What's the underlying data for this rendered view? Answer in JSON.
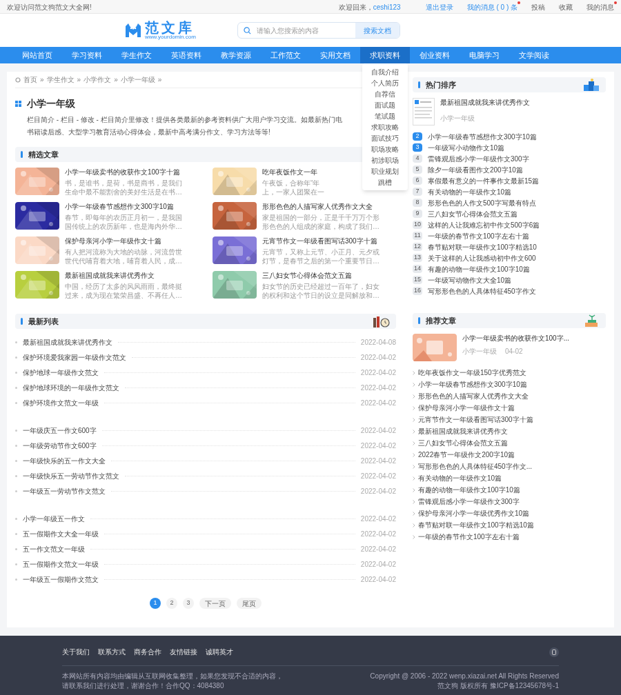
{
  "top_bar": {
    "welcome": "欢迎访问范文狗范文大全网!",
    "greeting": "欢迎回来，",
    "username": "ceshi123",
    "links": [
      {
        "label": "退出登录",
        "kind": "link",
        "unread": false
      },
      {
        "label": "我的消息 ( 0 ) 条",
        "kind": "link",
        "unread": true
      },
      {
        "label": "投稿",
        "kind": "plain",
        "unread": false
      },
      {
        "label": "收藏",
        "kind": "plain",
        "unread": false
      },
      {
        "label": "我的消息",
        "kind": "plain",
        "unread": true
      }
    ]
  },
  "header": {
    "logo": {
      "name": "范文库",
      "domain": "www.yourdomin.com"
    },
    "search": {
      "placeholder": "请输入您搜索的内容",
      "button": "搜索文档"
    }
  },
  "nav": {
    "items": [
      {
        "label": "网站首页",
        "selected": false
      },
      {
        "label": "学习资料",
        "selected": false
      },
      {
        "label": "学生作文",
        "selected": false
      },
      {
        "label": "英语资料",
        "selected": false
      },
      {
        "label": "教学资源",
        "selected": false
      },
      {
        "label": "工作范文",
        "selected": false
      },
      {
        "label": "实用文档",
        "selected": false
      },
      {
        "label": "求职资料",
        "selected": true,
        "dropdown": [
          "自我介绍",
          "个人简历",
          "自荐信",
          "面试题",
          "笔试题",
          "求职攻略",
          "面试技巧",
          "职场攻略",
          "初涉职场",
          "职业规划",
          "跳槽"
        ]
      },
      {
        "label": "创业资料",
        "selected": false
      },
      {
        "label": "电脑学习",
        "selected": false
      },
      {
        "label": "文学阅读",
        "selected": false
      }
    ]
  },
  "breadcrumb": {
    "separator": "»",
    "items": [
      "首页",
      "学生作文",
      "小学作文",
      "小学一年级"
    ]
  },
  "category": {
    "title": "小学一年级",
    "intro_lines": [
      "栏目简介 - 栏目 - 修改 - 栏目简介里修改！提供各类最新的参考资料供广大用户学习交流。如最新热门电",
      "书籍读后感、大型学习教育活动心得体会，最新中高考满分作文、学习方法等等!"
    ]
  },
  "featured": {
    "title": "精选文章",
    "articles": [
      {
        "title": "小学一年级卖书的收获作文100字十篇",
        "desc_lines": [
          "书，是谁书，是荷，书是商书，是我们",
          "生命中最不能割舍的美好生活是在书…"
        ],
        "color": "#f4b497"
      },
      {
        "title": "吃年夜饭作文一年",
        "desc_lines": [
          "午夜饭，合称年“年",
          "上，一家人团聚在一"
        ],
        "color": "#f7dcaa"
      },
      {
        "title": "小学一年级春节感想作文300字10篇",
        "desc_lines": [
          "春节，即每年的农历正月初一，是我国",
          "国传统上的农历新年，也是海内外华…"
        ],
        "color": "#2b2ba0"
      },
      {
        "title": "形形色色的人描写家人优秀作文大全",
        "desc_lines": [
          "家是祖国的一部分，正是千千万万个形",
          "形色色的人组成的家庭，构成了我们…"
        ],
        "color": "#c6643e"
      },
      {
        "title": "保护母亲河小学一年级作文十篇",
        "desc_lines": [
          "有人把河流称为大地的动脉，河流曾世",
          "世代代哺育着大地，哺育着人民，成…"
        ],
        "color": "#fbd9c6"
      },
      {
        "title": "元宵节作文一年级看图写话300字十篇",
        "desc_lines": [
          "元宵节，又称上元节、小正月、元夕或",
          "灯节，是春节之后的第一个重要节日…"
        ],
        "color": "#7a6fd6"
      },
      {
        "title": "最新祖国成就我来讲优秀作文",
        "desc_lines": [
          "中国，经历了太多的风风雨雨，最终挺",
          "过来，成为现在繁荣昌盛、不再任人…"
        ],
        "color": "#b8cf3f"
      },
      {
        "title": "三八妇女节心得体会范文五篇",
        "desc_lines": [
          "妇女节的历史已经超过一百年了，妇女",
          "的权利和这个节日的设立是同解放和…"
        ],
        "color": "#8fcbab"
      }
    ]
  },
  "latest": {
    "title": "最新列表",
    "groups": [
      [
        {
          "title": "最新祖国成就我来讲优秀作文",
          "date": "2022-04-08"
        },
        {
          "title": "保护环境爱我家园一年级作文范文",
          "date": "2022-04-02"
        },
        {
          "title": "保护地球一年级作文范文",
          "date": "2022-04-02"
        },
        {
          "title": "保护地球环境的一年级作文范文",
          "date": "2022-04-02"
        },
        {
          "title": "保护环境作文范文一年级",
          "date": "2022-04-02"
        }
      ],
      [
        {
          "title": "一年级庆五一作文600字",
          "date": "2022-04-02"
        },
        {
          "title": "一年级劳动节作文600字",
          "date": "2022-04-02"
        },
        {
          "title": "一年级快乐的五一作文大全",
          "date": "2022-04-02"
        },
        {
          "title": "一年级快乐五一劳动节作文范文",
          "date": "2022-04-02"
        },
        {
          "title": "一年级五一劳动节作文范文",
          "date": "2022-04-02"
        }
      ],
      [
        {
          "title": "小学一年级五一作文",
          "date": "2022-04-02"
        },
        {
          "title": "五一假期作文大全一年级",
          "date": "2022-04-02"
        },
        {
          "title": "五一作文范文一年级",
          "date": "2022-04-02"
        },
        {
          "title": "五一假期作文范文一年级",
          "date": "2022-04-02"
        },
        {
          "title": "一年级五一假期作文范文",
          "date": "2022-04-02"
        }
      ]
    ]
  },
  "pagination": {
    "pages": [
      {
        "label": "1",
        "selected": true
      },
      {
        "label": "2",
        "selected": false
      },
      {
        "label": "3",
        "selected": false
      }
    ],
    "next": "下一页",
    "last": "尾页"
  },
  "hot": {
    "title": "热门排序",
    "lead": {
      "title": "最新祖国成就我来讲优秀作文",
      "category": "小学一年级"
    },
    "items": [
      {
        "rank": "2",
        "title": "小学一年级春节感想作文300字10篇",
        "top": true
      },
      {
        "rank": "3",
        "title": "一年级写小动物作文10篇",
        "top": true
      },
      {
        "rank": "4",
        "title": "雷锋观后感小学一年级作文300字",
        "top": false
      },
      {
        "rank": "5",
        "title": "除夕一年级看图作文200字10篇",
        "top": false
      },
      {
        "rank": "6",
        "title": "寒假最有意义的一件事作文最新15篇",
        "top": false
      },
      {
        "rank": "7",
        "title": "有关动物的一年级作文10篇",
        "top": false
      },
      {
        "rank": "8",
        "title": "形形色色的人作文500字写最有特点",
        "top": false
      },
      {
        "rank": "9",
        "title": "三八妇女节心得体会范文五篇",
        "top": false
      },
      {
        "rank": "10",
        "title": "这样的人让我难忘初中作文500字6篇",
        "top": false
      },
      {
        "rank": "11",
        "title": "一年级的春节作文100字左右十篇",
        "top": false
      },
      {
        "rank": "12",
        "title": "春节贴对联一年级作文100字精选10",
        "top": false
      },
      {
        "rank": "13",
        "title": "关于这样的人让我感动初中作文600",
        "top": false
      },
      {
        "rank": "14",
        "title": "有趣的动物一年级作文100字10篇",
        "top": false
      },
      {
        "rank": "15",
        "title": "一年级写动物作文大全10篇",
        "top": false
      },
      {
        "rank": "16",
        "title": "写形形色色的人具体特征450字作文",
        "top": false
      }
    ]
  },
  "recommended": {
    "title": "推荐文章",
    "lead": {
      "title": "小学一年级卖书的收获作文100字...",
      "category": "小学一年级",
      "date": "04-02"
    },
    "items": [
      "吃年夜饭作文一年级150字优秀范文",
      "小学一年级春节感想作文300字10篇",
      "形形色色的人描写家人优秀作文大全",
      "保护母亲河小学一年级作文十篇",
      "元宵节作文一年级看图写话300字十篇",
      "最新祖国成就我来讲优秀作文",
      "三八妇女节心得体会范文五篇",
      "2022春节一年级作文200字10篇",
      "写形形色色的人具体特征450字作文...",
      "有关动物的一年级作文10篇",
      "有趣的动物一年级作文100字10篇",
      "雷锋观后感小学一年级作文300字",
      "保护母亲河小学一年级优秀作文10篇",
      "春节贴对联一年级作文100字精选10篇",
      "一年级的春节作文100字左右十篇"
    ]
  },
  "footer": {
    "links": [
      "关于我们",
      "联系方式",
      "商务合作",
      "友情链接",
      "诚聘英才"
    ],
    "notice_lines": [
      "本网站所有内容均由编辑从互联网收集整理，如果您发现不合适的内容，",
      "请联系我们进行处理，谢谢合作！合作QQ：4084380"
    ],
    "copyright_lines": [
      "Copyright @ 2006 - 2022 wenp.xiazai.net All Rights Reserved",
      "范文狗 版权所有   豫ICP备12345678号-1"
    ]
  }
}
